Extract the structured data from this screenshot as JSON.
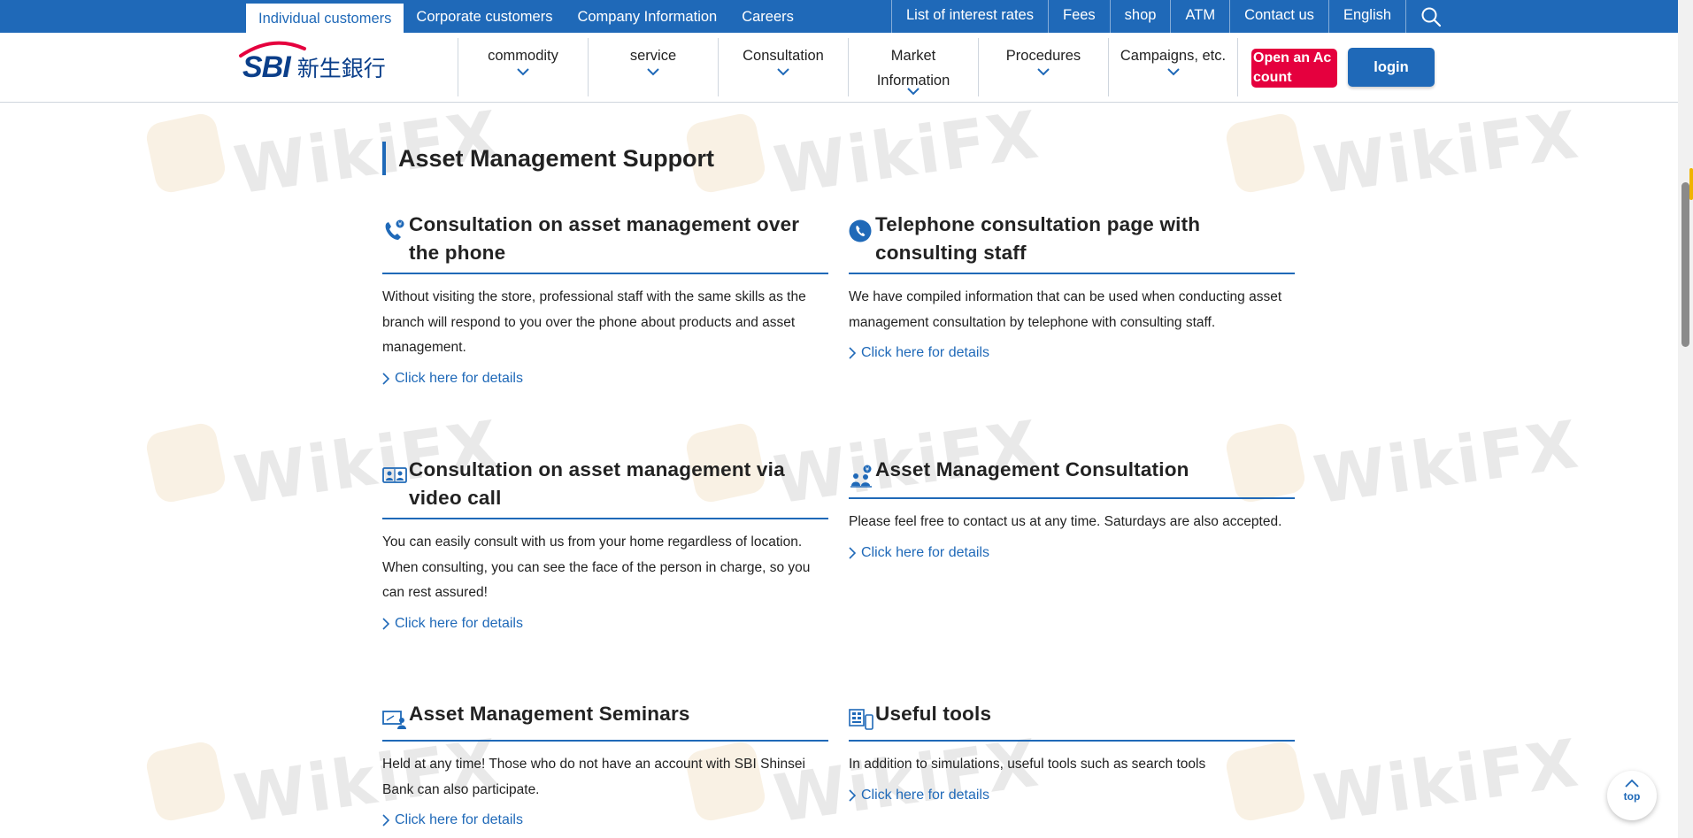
{
  "topbar": {
    "left_items": [
      {
        "label": "Individual customers",
        "active": true
      },
      {
        "label": "Corporate customers",
        "active": false
      },
      {
        "label": "Company Information",
        "active": false
      },
      {
        "label": "Careers",
        "active": false
      }
    ],
    "right_items": [
      {
        "label": "List of interest rates"
      },
      {
        "label": "Fees"
      },
      {
        "label": "shop"
      },
      {
        "label": "ATM"
      },
      {
        "label": "Contact us"
      },
      {
        "label": "English"
      }
    ],
    "search_icon": "search-icon"
  },
  "header": {
    "logo_text": "SBI",
    "logo_kanji": "新生銀行",
    "menu": [
      {
        "line1": "commodity",
        "line2": ""
      },
      {
        "line1": "service",
        "line2": ""
      },
      {
        "line1": "Consultation",
        "line2": ""
      },
      {
        "line1": "Market",
        "line2": "Information"
      },
      {
        "line1": "Procedures",
        "line2": ""
      },
      {
        "line1": "Campaigns, etc.",
        "line2": ""
      }
    ],
    "open_account_line1": "Open an Ac",
    "open_account_line2": "count",
    "login_label": "login"
  },
  "main": {
    "title": "Asset Management Support",
    "cards": [
      {
        "icon": "phone-icon",
        "title": "Consultation on asset management over the phone",
        "text": "Without visiting the store, professional staff with the same skills as the branch will respond to you over the phone about products and asset management.",
        "link": "Click here for details"
      },
      {
        "icon": "telephone-staff-icon",
        "title": "Telephone consultation page with consulting staff",
        "text": "We have compiled information that can be used when conducting asset management consultation by telephone with consulting staff.",
        "link": "Click here for details"
      },
      {
        "icon": "video-call-icon",
        "title": "Consultation on asset management via video call",
        "text": "You can easily consult with us from your home regardless of location. When consulting, you can see the face of the person in charge, so you can rest assured!",
        "link": "Click here for details"
      },
      {
        "icon": "consultation-people-icon",
        "title": "Asset Management Consultation",
        "text": "Please feel free to contact us at any time. Saturdays are also accepted.",
        "link": "Click here for details"
      },
      {
        "icon": "seminar-icon",
        "title": "Asset Management Seminars",
        "text": "Held at any time! Those who do not have an account with SBI Shinsei Bank can also participate.",
        "link": "Click here for details"
      },
      {
        "icon": "tools-icon",
        "title": "Useful tools",
        "text": "In addition to simulations, useful tools such as search tools",
        "link": "Click here for details"
      }
    ]
  },
  "watermark_text": "WikiFX",
  "back_to_top_label": "top",
  "colors": {
    "brand_blue": "#1f69b8",
    "open_account_red": "#e5003e",
    "logo_navy": "#0b3f8a"
  }
}
